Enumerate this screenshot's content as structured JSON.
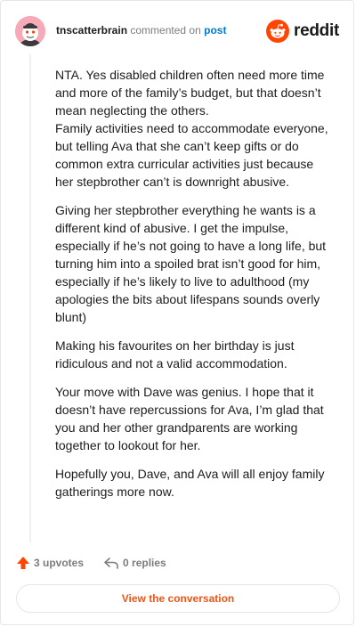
{
  "comment": {
    "username": "tnscatterbrain",
    "action_text": "commented on",
    "post_link_text": "post"
  },
  "brand": {
    "name": "reddit",
    "logo_color": "#ff4500",
    "icon": "reddit-alien-icon"
  },
  "body": {
    "paragraphs": [
      [
        "NTA. Yes disabled children often need more time",
        "and more of the family’s budget, but that doesn’t",
        "mean neglecting the others.",
        "Family activities need to accommodate everyone,",
        "but telling Ava that she can’t keep gifts or do",
        "common extra curricular activities just because",
        "her stepbrother can’t is downright abusive."
      ],
      [
        "Giving her stepbrother everything he wants is a",
        "different kind of abusive. I get the impulse,",
        "especially if he’s not going to have a long life, but",
        "turning him into a spoiled brat isn’t good for him,",
        "especially if he’s likely to live to adulthood (my",
        "apologies the bits about lifespans sounds overly",
        "blunt)"
      ],
      [
        "Making his favourites on her birthday is just",
        "ridiculous and not a valid accommodation."
      ],
      [
        "Your move with Dave was genius. I hope that it",
        "doesn’t have repercussions for Ava, I’m glad that",
        "you and her other grandparents are working",
        "together to lookout for her."
      ],
      [
        "Hopefully you, Dave, and Ava will all enjoy family",
        "gatherings more now."
      ]
    ]
  },
  "actions": {
    "upvotes": "3 upvotes",
    "replies": "0 replies",
    "upvote_icon": "upvote-arrow-icon",
    "reply_icon": "reply-arrow-icon",
    "accent_color": "#ff4500"
  },
  "footer": {
    "view_label": "View the conversation",
    "link_color": "#ec5418"
  }
}
